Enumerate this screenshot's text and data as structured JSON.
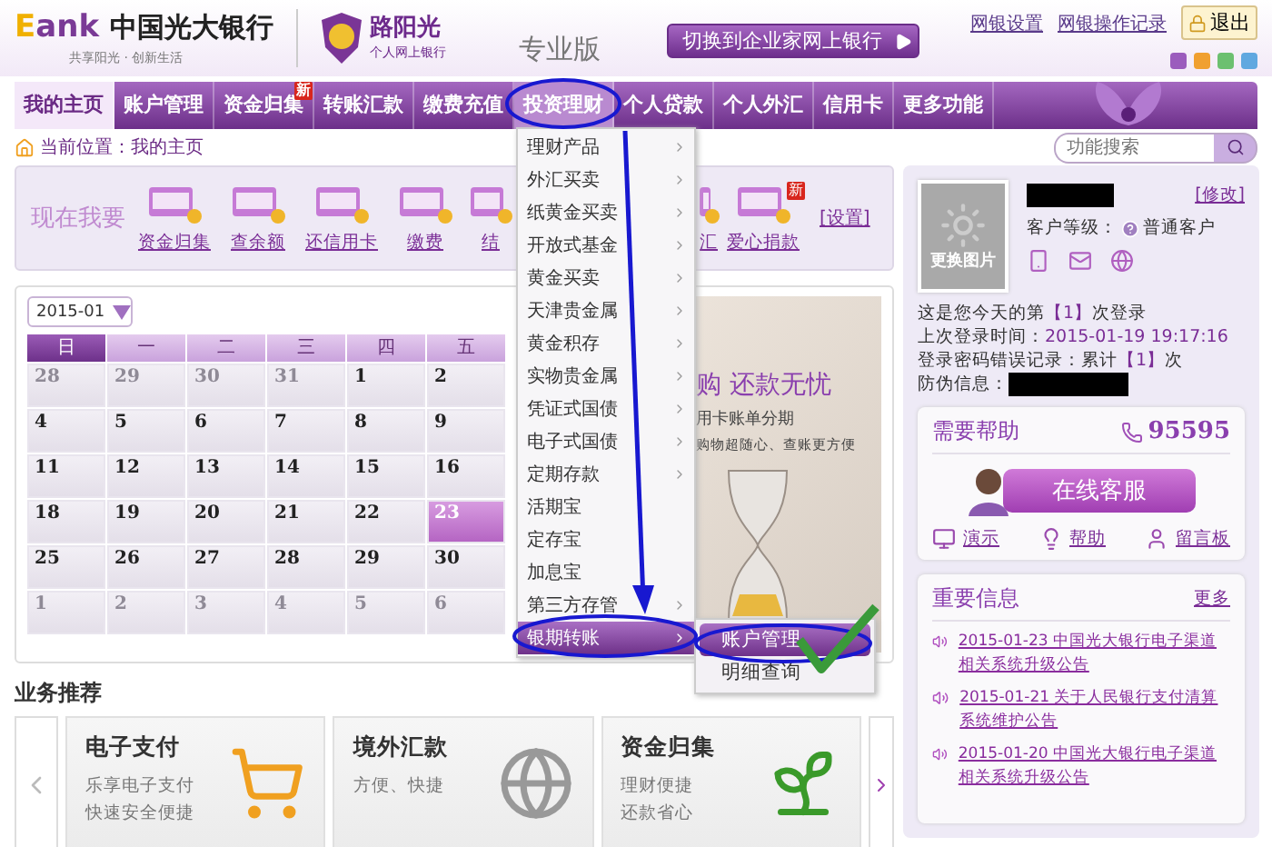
{
  "header": {
    "logo_mark": "E",
    "logo_text": "ank",
    "bank_name": "中国光大银行",
    "slogan": "共享阳光 · 创新生活",
    "brand": "路阳光",
    "brand_sub": "个人网上银行",
    "edition": "专业版",
    "switch_button": "切换到企业家网上银行",
    "links": [
      "网银设置",
      "网银操作记录"
    ],
    "logout": "退出"
  },
  "nav": [
    {
      "label": "我的主页",
      "selected": true,
      "expanded": false
    },
    {
      "label": "账户管理",
      "selected": false,
      "expanded": false
    },
    {
      "label": "资金归集",
      "selected": false,
      "expanded": false,
      "badge": "新"
    },
    {
      "label": "转账汇款",
      "selected": false,
      "expanded": false
    },
    {
      "label": "缴费充值",
      "selected": false,
      "expanded": false
    },
    {
      "label": "投资理财",
      "selected": false,
      "expanded": true
    },
    {
      "label": "个人贷款",
      "selected": false,
      "expanded": false
    },
    {
      "label": "个人外汇",
      "selected": false,
      "expanded": false
    },
    {
      "label": "信用卡",
      "selected": false,
      "expanded": false
    },
    {
      "label": "更多功能",
      "selected": false,
      "expanded": false
    }
  ],
  "breadcrumb": "当前位置：我的主页",
  "search": {
    "placeholder": "功能搜索"
  },
  "quick": {
    "label": "现在我要",
    "items": [
      {
        "label": "资金归集",
        "kind": "full"
      },
      {
        "label": "查余额",
        "kind": "full"
      },
      {
        "label": "还信用卡",
        "kind": "full"
      },
      {
        "label": "缴费",
        "kind": "full"
      },
      {
        "label": "结",
        "kind": "cut_right"
      },
      {
        "label": "汇",
        "kind": "cut_left"
      },
      {
        "label": "爱心捐款",
        "kind": "full",
        "badge": "新"
      }
    ],
    "settings": "[设置]"
  },
  "calendar": {
    "month": "2015-01",
    "weekdays": [
      "日",
      "一",
      "二",
      "三",
      "四",
      "五"
    ],
    "weeks": [
      [
        {
          "day": "28",
          "muted": true,
          "selected": false
        },
        {
          "day": "29",
          "muted": true,
          "selected": false
        },
        {
          "day": "30",
          "muted": true,
          "selected": false
        },
        {
          "day": "31",
          "muted": true,
          "selected": false
        },
        {
          "day": "1",
          "muted": false,
          "selected": false
        },
        {
          "day": "2",
          "muted": false,
          "selected": false
        }
      ],
      [
        {
          "day": "4",
          "muted": false,
          "selected": false
        },
        {
          "day": "5",
          "muted": false,
          "selected": false
        },
        {
          "day": "6",
          "muted": false,
          "selected": false
        },
        {
          "day": "7",
          "muted": false,
          "selected": false
        },
        {
          "day": "8",
          "muted": false,
          "selected": false
        },
        {
          "day": "9",
          "muted": false,
          "selected": false
        }
      ],
      [
        {
          "day": "11",
          "muted": false,
          "selected": false
        },
        {
          "day": "12",
          "muted": false,
          "selected": false
        },
        {
          "day": "13",
          "muted": false,
          "selected": false
        },
        {
          "day": "14",
          "muted": false,
          "selected": false
        },
        {
          "day": "15",
          "muted": false,
          "selected": false
        },
        {
          "day": "16",
          "muted": false,
          "selected": false
        }
      ],
      [
        {
          "day": "18",
          "muted": false,
          "selected": false
        },
        {
          "day": "19",
          "muted": false,
          "selected": false
        },
        {
          "day": "20",
          "muted": false,
          "selected": false
        },
        {
          "day": "21",
          "muted": false,
          "selected": false
        },
        {
          "day": "22",
          "muted": false,
          "selected": false
        },
        {
          "day": "23",
          "muted": false,
          "selected": true
        }
      ],
      [
        {
          "day": "25",
          "muted": false,
          "selected": false
        },
        {
          "day": "26",
          "muted": false,
          "selected": false
        },
        {
          "day": "27",
          "muted": false,
          "selected": false
        },
        {
          "day": "28",
          "muted": false,
          "selected": false
        },
        {
          "day": "29",
          "muted": false,
          "selected": false
        },
        {
          "day": "30",
          "muted": false,
          "selected": false
        }
      ],
      [
        {
          "day": "1",
          "muted": true,
          "selected": false
        },
        {
          "day": "2",
          "muted": true,
          "selected": false
        },
        {
          "day": "3",
          "muted": true,
          "selected": false
        },
        {
          "day": "4",
          "muted": true,
          "selected": false
        },
        {
          "day": "5",
          "muted": true,
          "selected": false
        },
        {
          "day": "6",
          "muted": true,
          "selected": false
        }
      ]
    ]
  },
  "banner": {
    "headline": "购 还款无忧",
    "line": "用卡账单分期",
    "sub": "购物超随心、查账更方便"
  },
  "menu": [
    {
      "label": "理财产品",
      "submenu": true,
      "selected": false
    },
    {
      "label": "外汇买卖",
      "submenu": true,
      "selected": false
    },
    {
      "label": "纸黄金买卖",
      "submenu": true,
      "selected": false
    },
    {
      "label": "开放式基金",
      "submenu": true,
      "selected": false
    },
    {
      "label": "黄金买卖",
      "submenu": true,
      "selected": false
    },
    {
      "label": "天津贵金属",
      "submenu": true,
      "selected": false
    },
    {
      "label": "黄金积存",
      "submenu": true,
      "selected": false
    },
    {
      "label": "实物贵金属",
      "submenu": true,
      "selected": false
    },
    {
      "label": "凭证式国债",
      "submenu": true,
      "selected": false
    },
    {
      "label": "电子式国债",
      "submenu": true,
      "selected": false
    },
    {
      "label": "定期存款",
      "submenu": true,
      "selected": false
    },
    {
      "label": "活期宝",
      "submenu": false,
      "selected": false
    },
    {
      "label": "定存宝",
      "submenu": false,
      "selected": false
    },
    {
      "label": "加息宝",
      "submenu": false,
      "selected": false
    },
    {
      "label": "第三方存管",
      "submenu": true,
      "selected": false
    },
    {
      "label": "银期转账",
      "submenu": true,
      "selected": true
    }
  ],
  "submenu": [
    {
      "label": "账户管理",
      "selected": true
    },
    {
      "label": "明细查询",
      "selected": false
    }
  ],
  "recommend": {
    "title": "业务推荐",
    "cards": [
      {
        "title": "电子支付",
        "lines": [
          "乐享电子支付",
          "快速安全便捷"
        ],
        "kind": "cart"
      },
      {
        "title": "境外汇款",
        "lines": [
          "方便、快捷"
        ],
        "kind": "globe"
      },
      {
        "title": "资金归集",
        "lines": [
          "理财便捷",
          "还款省心"
        ],
        "kind": "sprout"
      }
    ]
  },
  "profile": {
    "photo_label": "更换图片",
    "edit": "[修改]",
    "level_label": "客户等级：",
    "level": "普通客户",
    "lines": [
      {
        "label": "这是您今天的第",
        "value": "【1】",
        "suffix": "次登录"
      },
      {
        "label": "上次登录时间：",
        "value": "2015-01-19 19:17:16"
      },
      {
        "label": "登录密码错误记录：累计",
        "value": "【1】",
        "suffix": "次"
      }
    ],
    "security_label": "防伪信息："
  },
  "help": {
    "title": "需要帮助",
    "phone": "95595",
    "button": "在线客服",
    "links": [
      {
        "label": "演示",
        "kind": "demo"
      },
      {
        "label": "帮助",
        "kind": "help"
      },
      {
        "label": "留言板",
        "kind": "board"
      }
    ]
  },
  "news": {
    "title": "重要信息",
    "more": "更多",
    "items": [
      "2015-01-23  中国光大银行电子渠道相关系统升级公告",
      "2015-01-21  关于人民银行支付清算系统维护公告",
      "2015-01-20  中国光大银行电子渠道相关系统升级公告"
    ]
  }
}
